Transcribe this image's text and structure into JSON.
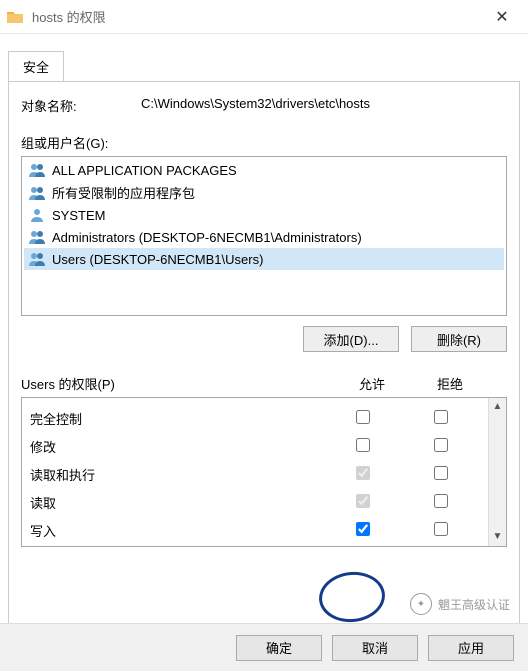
{
  "titlebar": {
    "title": "hosts 的权限"
  },
  "tab": {
    "label": "安全"
  },
  "object": {
    "label": "对象名称:",
    "value": "C:\\Windows\\System32\\drivers\\etc\\hosts"
  },
  "groups": {
    "label": "组或用户名(G):",
    "items": [
      {
        "icon": "group",
        "text": "ALL APPLICATION PACKAGES",
        "selected": false
      },
      {
        "icon": "group",
        "text": "所有受限制的应用程序包",
        "selected": false
      },
      {
        "icon": "user",
        "text": "SYSTEM",
        "selected": false
      },
      {
        "icon": "group",
        "text": "Administrators (DESKTOP-6NECMB1\\Administrators)",
        "selected": false
      },
      {
        "icon": "group",
        "text": "Users (DESKTOP-6NECMB1\\Users)",
        "selected": true
      }
    ]
  },
  "buttons": {
    "add": "添加(D)...",
    "remove": "删除(R)"
  },
  "perms": {
    "label": "Users 的权限(P)",
    "allow": "允许",
    "deny": "拒绝",
    "rows": [
      {
        "name": "完全控制",
        "allow": false,
        "deny": false,
        "disabled": false
      },
      {
        "name": "修改",
        "allow": false,
        "deny": false,
        "disabled": false
      },
      {
        "name": "读取和执行",
        "allow": true,
        "deny": false,
        "disabled": true
      },
      {
        "name": "读取",
        "allow": true,
        "deny": false,
        "disabled": true
      },
      {
        "name": "写入",
        "allow": true,
        "deny": false,
        "disabled": false
      }
    ]
  },
  "footer": {
    "ok": "确定",
    "cancel": "取消",
    "apply": "应用"
  },
  "watermark": "魍王高级认证"
}
